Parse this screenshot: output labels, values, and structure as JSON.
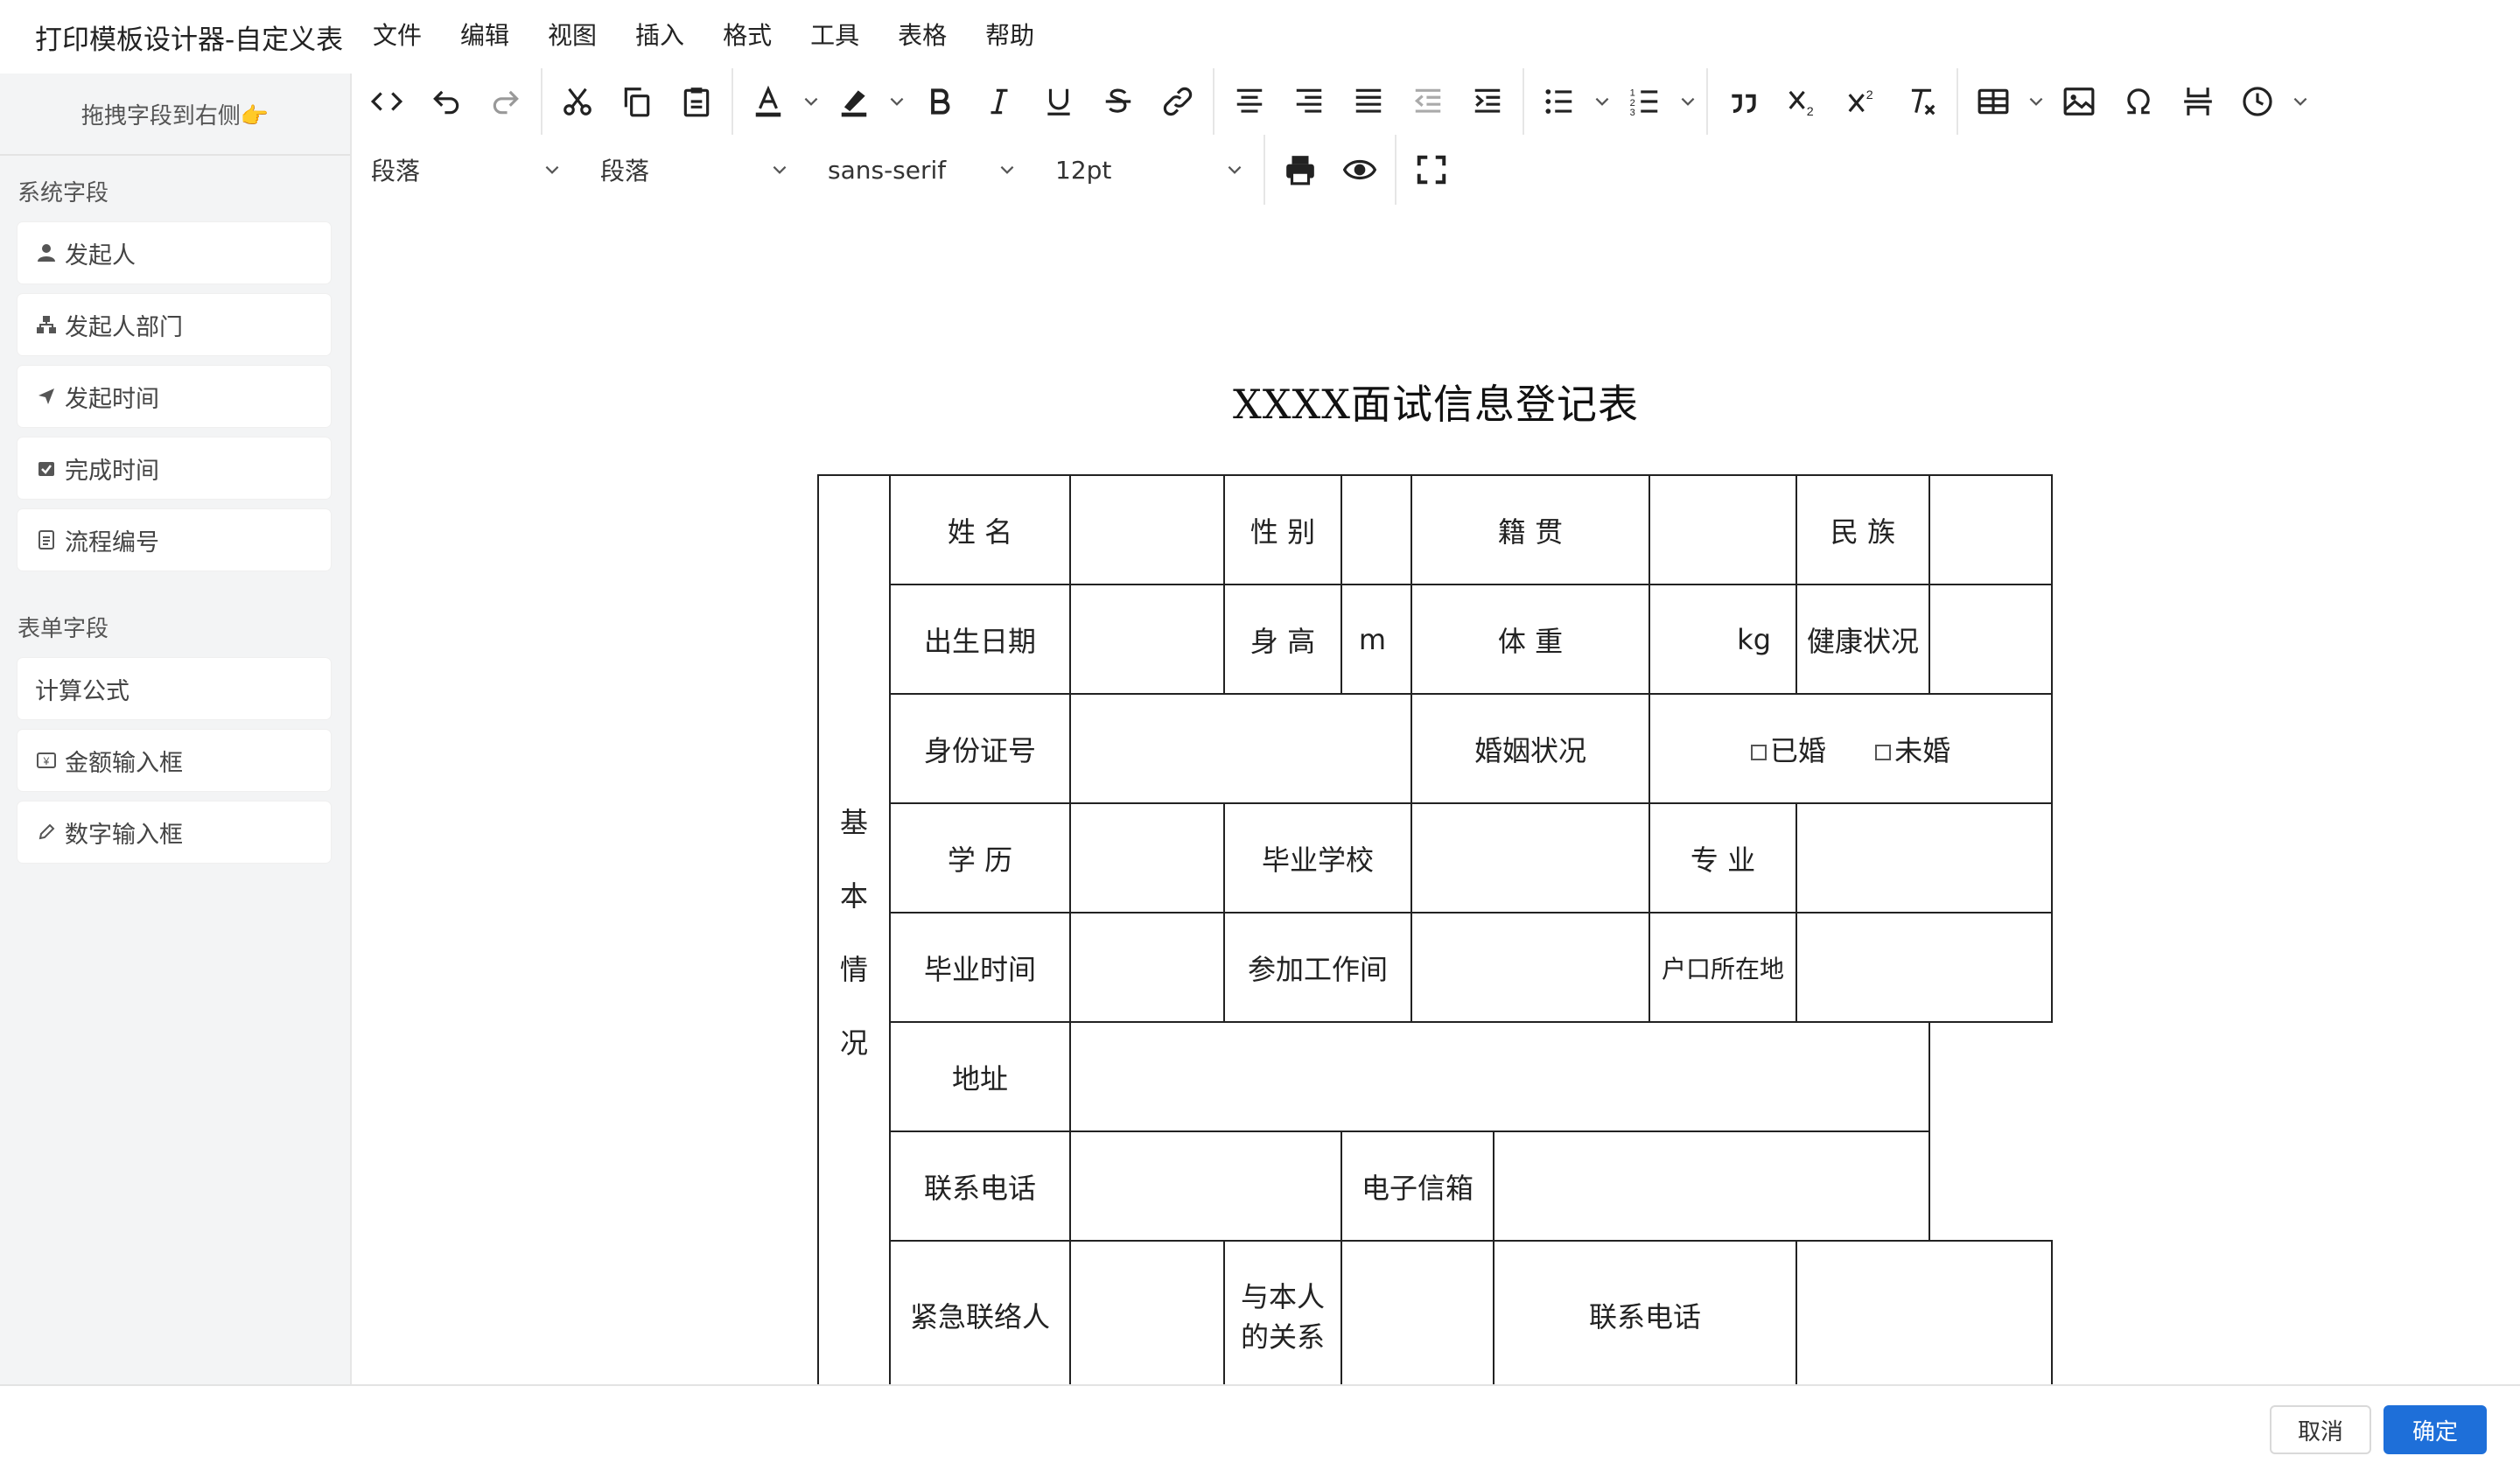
{
  "app": {
    "title": "打印模板设计器-自定义表"
  },
  "menubar": {
    "items": [
      "文件",
      "编辑",
      "视图",
      "插入",
      "格式",
      "工具",
      "表格",
      "帮助"
    ]
  },
  "sidebar": {
    "hint": "拖拽字段到右侧👉",
    "system_section": "系统字段",
    "system_fields": [
      "发起人",
      "发起人部门",
      "发起时间",
      "完成时间",
      "流程编号"
    ],
    "form_section": "表单字段",
    "form_fields": [
      "计算公式",
      "金额输入框",
      "数字输入框"
    ]
  },
  "toolbar2": {
    "block_format": "段落",
    "paragraph": "段落",
    "font_family": "sans-serif",
    "font_size": "12pt"
  },
  "document": {
    "title": "XXXX面试信息登记表",
    "side_label": [
      "基",
      "本",
      "情",
      "况"
    ],
    "row1": [
      "姓 名",
      "性 别",
      "籍  贯",
      "民 族"
    ],
    "row2": [
      "出生日期",
      "身 高",
      "m",
      "体  重",
      "kg",
      "健康状况"
    ],
    "row3": [
      "身份证号",
      "婚姻状况",
      "已婚",
      "未婚"
    ],
    "row4": [
      "学 历",
      "毕业学校",
      "专 业"
    ],
    "row5": [
      "毕业时间",
      "参加工作间",
      "户口所在地"
    ],
    "row6": [
      "地址"
    ],
    "row7": [
      "联系电话",
      "电子信箱"
    ],
    "row8": [
      "紧急联络人",
      "与本人的关系",
      "联系电话"
    ]
  },
  "footer": {
    "cancel": "取消",
    "ok": "确定"
  },
  "colors": {
    "primary": "#1e6fd9",
    "sidebar_bg": "#f3f4f5",
    "border": "#222222"
  }
}
